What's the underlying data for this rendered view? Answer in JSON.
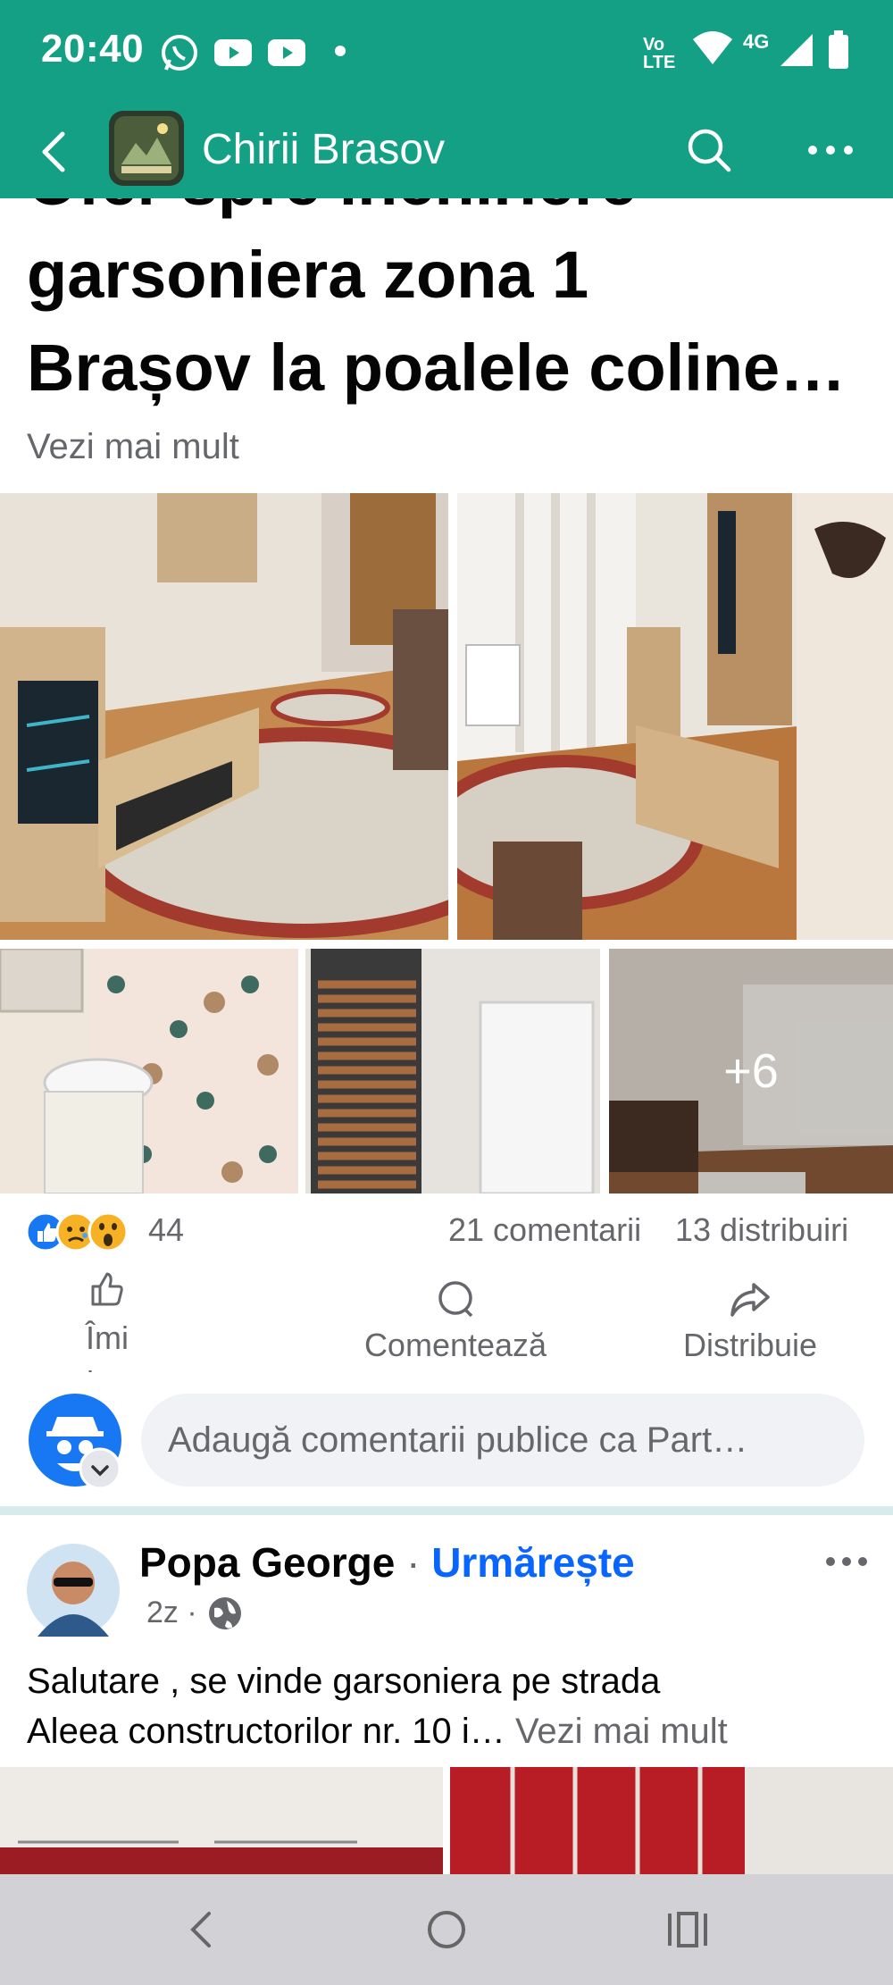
{
  "theme": {
    "accent": "#14a085",
    "link": "#0866ff",
    "muted": "#65676b"
  },
  "status_bar": {
    "time": "20:40",
    "network_label": "4G",
    "icons": [
      "whatsapp-icon",
      "youtube-icon",
      "youtube-icon",
      "dot-icon",
      "volte-icon",
      "wifi-icon",
      "signal-icon",
      "battery-icon"
    ],
    "volte_top": "Vo",
    "volte_bottom": "LTE"
  },
  "header": {
    "title": "Chirii Brasov",
    "icons": [
      "back-arrow-icon",
      "group-avatar",
      "search-icon",
      "more-icon"
    ]
  },
  "post": {
    "title_line_1": "Ofer spre închiriere",
    "title_line_2": "garsoniera zona 1",
    "title_line_3": "Brașov la poalele coline…",
    "see_more": "Vezi mai mult",
    "photos": [
      "living-room-photo-1",
      "living-room-photo-2",
      "bathroom-photo",
      "door-fridge-photo",
      "room-photo"
    ],
    "more_photos": "+6",
    "reactions": {
      "icons": [
        "like-icon",
        "sad-icon",
        "wow-icon"
      ],
      "count": "44"
    },
    "comments_count": "21 comentarii",
    "shares_count": "13 distribuiri",
    "actions": {
      "like": "Îmi place",
      "comment": "Comentează",
      "share": "Distribuie"
    },
    "comment_placeholder": "Adaugă comentarii publice ca Part…"
  },
  "next_post": {
    "author": "Popa George",
    "follow": "Urmărește",
    "time": "2z",
    "body_line_1": "Salutare , se vinde garsoniera pe strada",
    "body_line_2": "Aleea constructorilor nr. 10 i…",
    "see_more": "Vezi mai mult"
  },
  "nav_bar": {
    "icons": [
      "nav-back-icon",
      "nav-home-icon",
      "nav-recents-icon"
    ]
  }
}
